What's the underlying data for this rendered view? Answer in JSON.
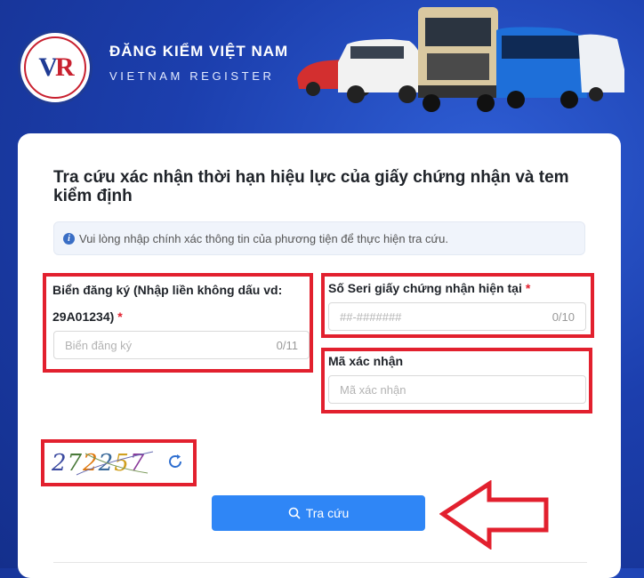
{
  "header": {
    "brand_main": "ĐĂNG KIỂM VIỆT NAM",
    "brand_sub": "VIETNAM REGISTER"
  },
  "form": {
    "title": "Tra cứu xác nhận thời hạn hiệu lực của giấy chứng nhận và tem kiểm định",
    "notice": "Vui lòng nhập chính xác thông tin của phương tiện để thực hiện tra cứu.",
    "plate": {
      "label_line1": "Biển đăng ký (Nhập liền không dấu vd:",
      "label_line2": "29A01234)",
      "required": "*",
      "placeholder": "Biển đăng ký",
      "counter": "0/11"
    },
    "serial": {
      "label": "Số Seri giấy chứng nhận hiện tại",
      "required": "*",
      "placeholder": "##-#######",
      "counter": "0/10"
    },
    "captcha_field": {
      "label": "Mã xác nhận",
      "placeholder": "Mã xác nhận"
    },
    "captcha_image_text": "272257",
    "submit_label": "Tra cứu"
  },
  "colors": {
    "highlight": "#e2202e",
    "button": "#2f86f6",
    "header_bg": "#1c3fae"
  }
}
